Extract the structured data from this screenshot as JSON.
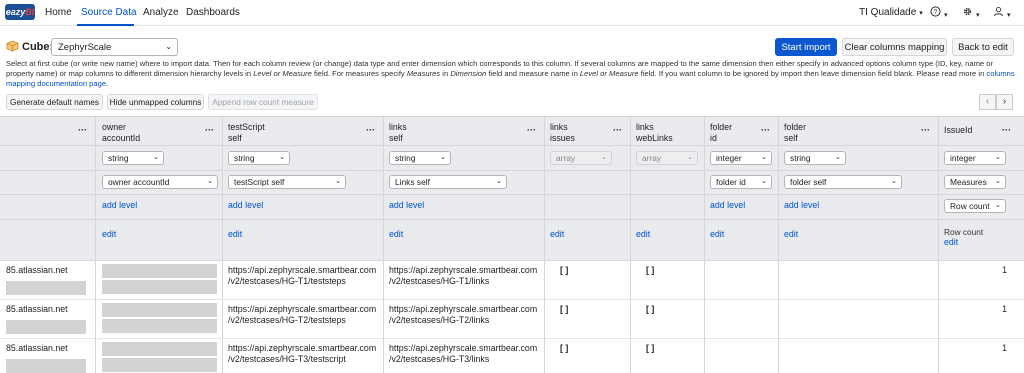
{
  "app": {
    "logo_text": "eazy",
    "logo_accent": "BI"
  },
  "nav": {
    "items": [
      {
        "label": "Home",
        "active": false
      },
      {
        "label": "Source Data",
        "active": true
      },
      {
        "label": "Analyze",
        "active": false
      },
      {
        "label": "Dashboards",
        "active": false
      }
    ],
    "account": "TI Qualidade",
    "help_icon": "question-circle-icon",
    "settings_icon": "gear-icon",
    "user_icon": "user-icon"
  },
  "cube": {
    "label": "Cube:",
    "value": "ZephyrScale"
  },
  "actions": {
    "start_import": "Start import",
    "clear_mapping": "Clear columns mapping",
    "back_to_edit": "Back to edit"
  },
  "instructions": {
    "text_1": "Select at first cube (or write new name) where to import data. Then for each column review (or change) data type and enter dimension which corresponds to this column. If several columns are mapped to the same dimension then either specify in advanced options column type (ID, key, name or property name) or map columns to different dimension hierarchy levels in ",
    "level_or_measure_1": "Level or Measure",
    "text_2": " field. For measures specify ",
    "measures": "Measures",
    "text_3": " in ",
    "dimension": "Dimension",
    "text_4": " field and measure name in ",
    "level_or_measure_2": "Level or Measure",
    "text_5": " field. If you want column to be ignored by import then leave dimension field blank. Please read more in ",
    "doc_link": "columns mapping documentation page",
    "text_6": "."
  },
  "toolbar": {
    "generate_names": "Generate default names",
    "hide_unmapped": "Hide unmapped columns",
    "append_row_count": "Append row count measure",
    "prev": "‹",
    "next": "›"
  },
  "columns": [
    {
      "title1": "",
      "title2": "",
      "type": "",
      "dimension": "",
      "add_level": "",
      "edit": ""
    },
    {
      "title1": "owner",
      "title2": "accountId",
      "type": "string",
      "dimension": "owner accountId",
      "add_level": "add level",
      "edit": "edit"
    },
    {
      "title1": "testScript",
      "title2": "self",
      "type": "string",
      "dimension": "testScript self",
      "add_level": "add level",
      "edit": "edit"
    },
    {
      "title1": "links",
      "title2": "self",
      "type": "string",
      "dimension": "Links self",
      "add_level": "add level",
      "edit": "edit"
    },
    {
      "title1": "links",
      "title2": "issues",
      "type": "array",
      "dimension": "",
      "add_level": "",
      "edit": "edit"
    },
    {
      "title1": "links",
      "title2": "webLinks",
      "type": "array",
      "dimension": "",
      "add_level": "",
      "edit": "edit"
    },
    {
      "title1": "folder",
      "title2": "id",
      "type": "integer",
      "dimension": "folder id",
      "add_level": "add level",
      "edit": "edit"
    },
    {
      "title1": "folder",
      "title2": "self",
      "type": "string",
      "dimension": "folder self",
      "add_level": "add level",
      "edit": "edit"
    },
    {
      "title1": "IssueId",
      "title2": "",
      "type": "integer",
      "dimension": "Measures",
      "level": "Row count",
      "level_label": "Row count",
      "edit": "edit"
    }
  ],
  "rows": [
    {
      "c0": "85.atlassian.net",
      "c2a": "https://api.zephyrscale.smartbear.com",
      "c2b": "/v2/testcases/HG-T1/teststeps",
      "c3a": "https://api.zephyrscale.smartbear.com",
      "c3b": "/v2/testcases/HG-T1/links",
      "c4": "[ ]",
      "c5": "[ ]",
      "c8": "1"
    },
    {
      "c0": "85.atlassian.net",
      "c2a": "https://api.zephyrscale.smartbear.com",
      "c2b": "/v2/testcases/HG-T2/teststeps",
      "c3a": "https://api.zephyrscale.smartbear.com",
      "c3b": "/v2/testcases/HG-T2/links",
      "c4": "[ ]",
      "c5": "[ ]",
      "c8": "1"
    },
    {
      "c0": "85.atlassian.net",
      "c2a": "https://api.zephyrscale.smartbear.com",
      "c2b": "/v2/testcases/HG-T3/testscript",
      "c3a": "https://api.zephyrscale.smartbear.com",
      "c3b": "/v2/testcases/HG-T3/links",
      "c4": "[ ]",
      "c5": "[ ]",
      "c8": "1"
    }
  ],
  "colors": {
    "primary": "#0b57d0",
    "link": "#0052cc",
    "header_bg": "#e9ebee"
  }
}
